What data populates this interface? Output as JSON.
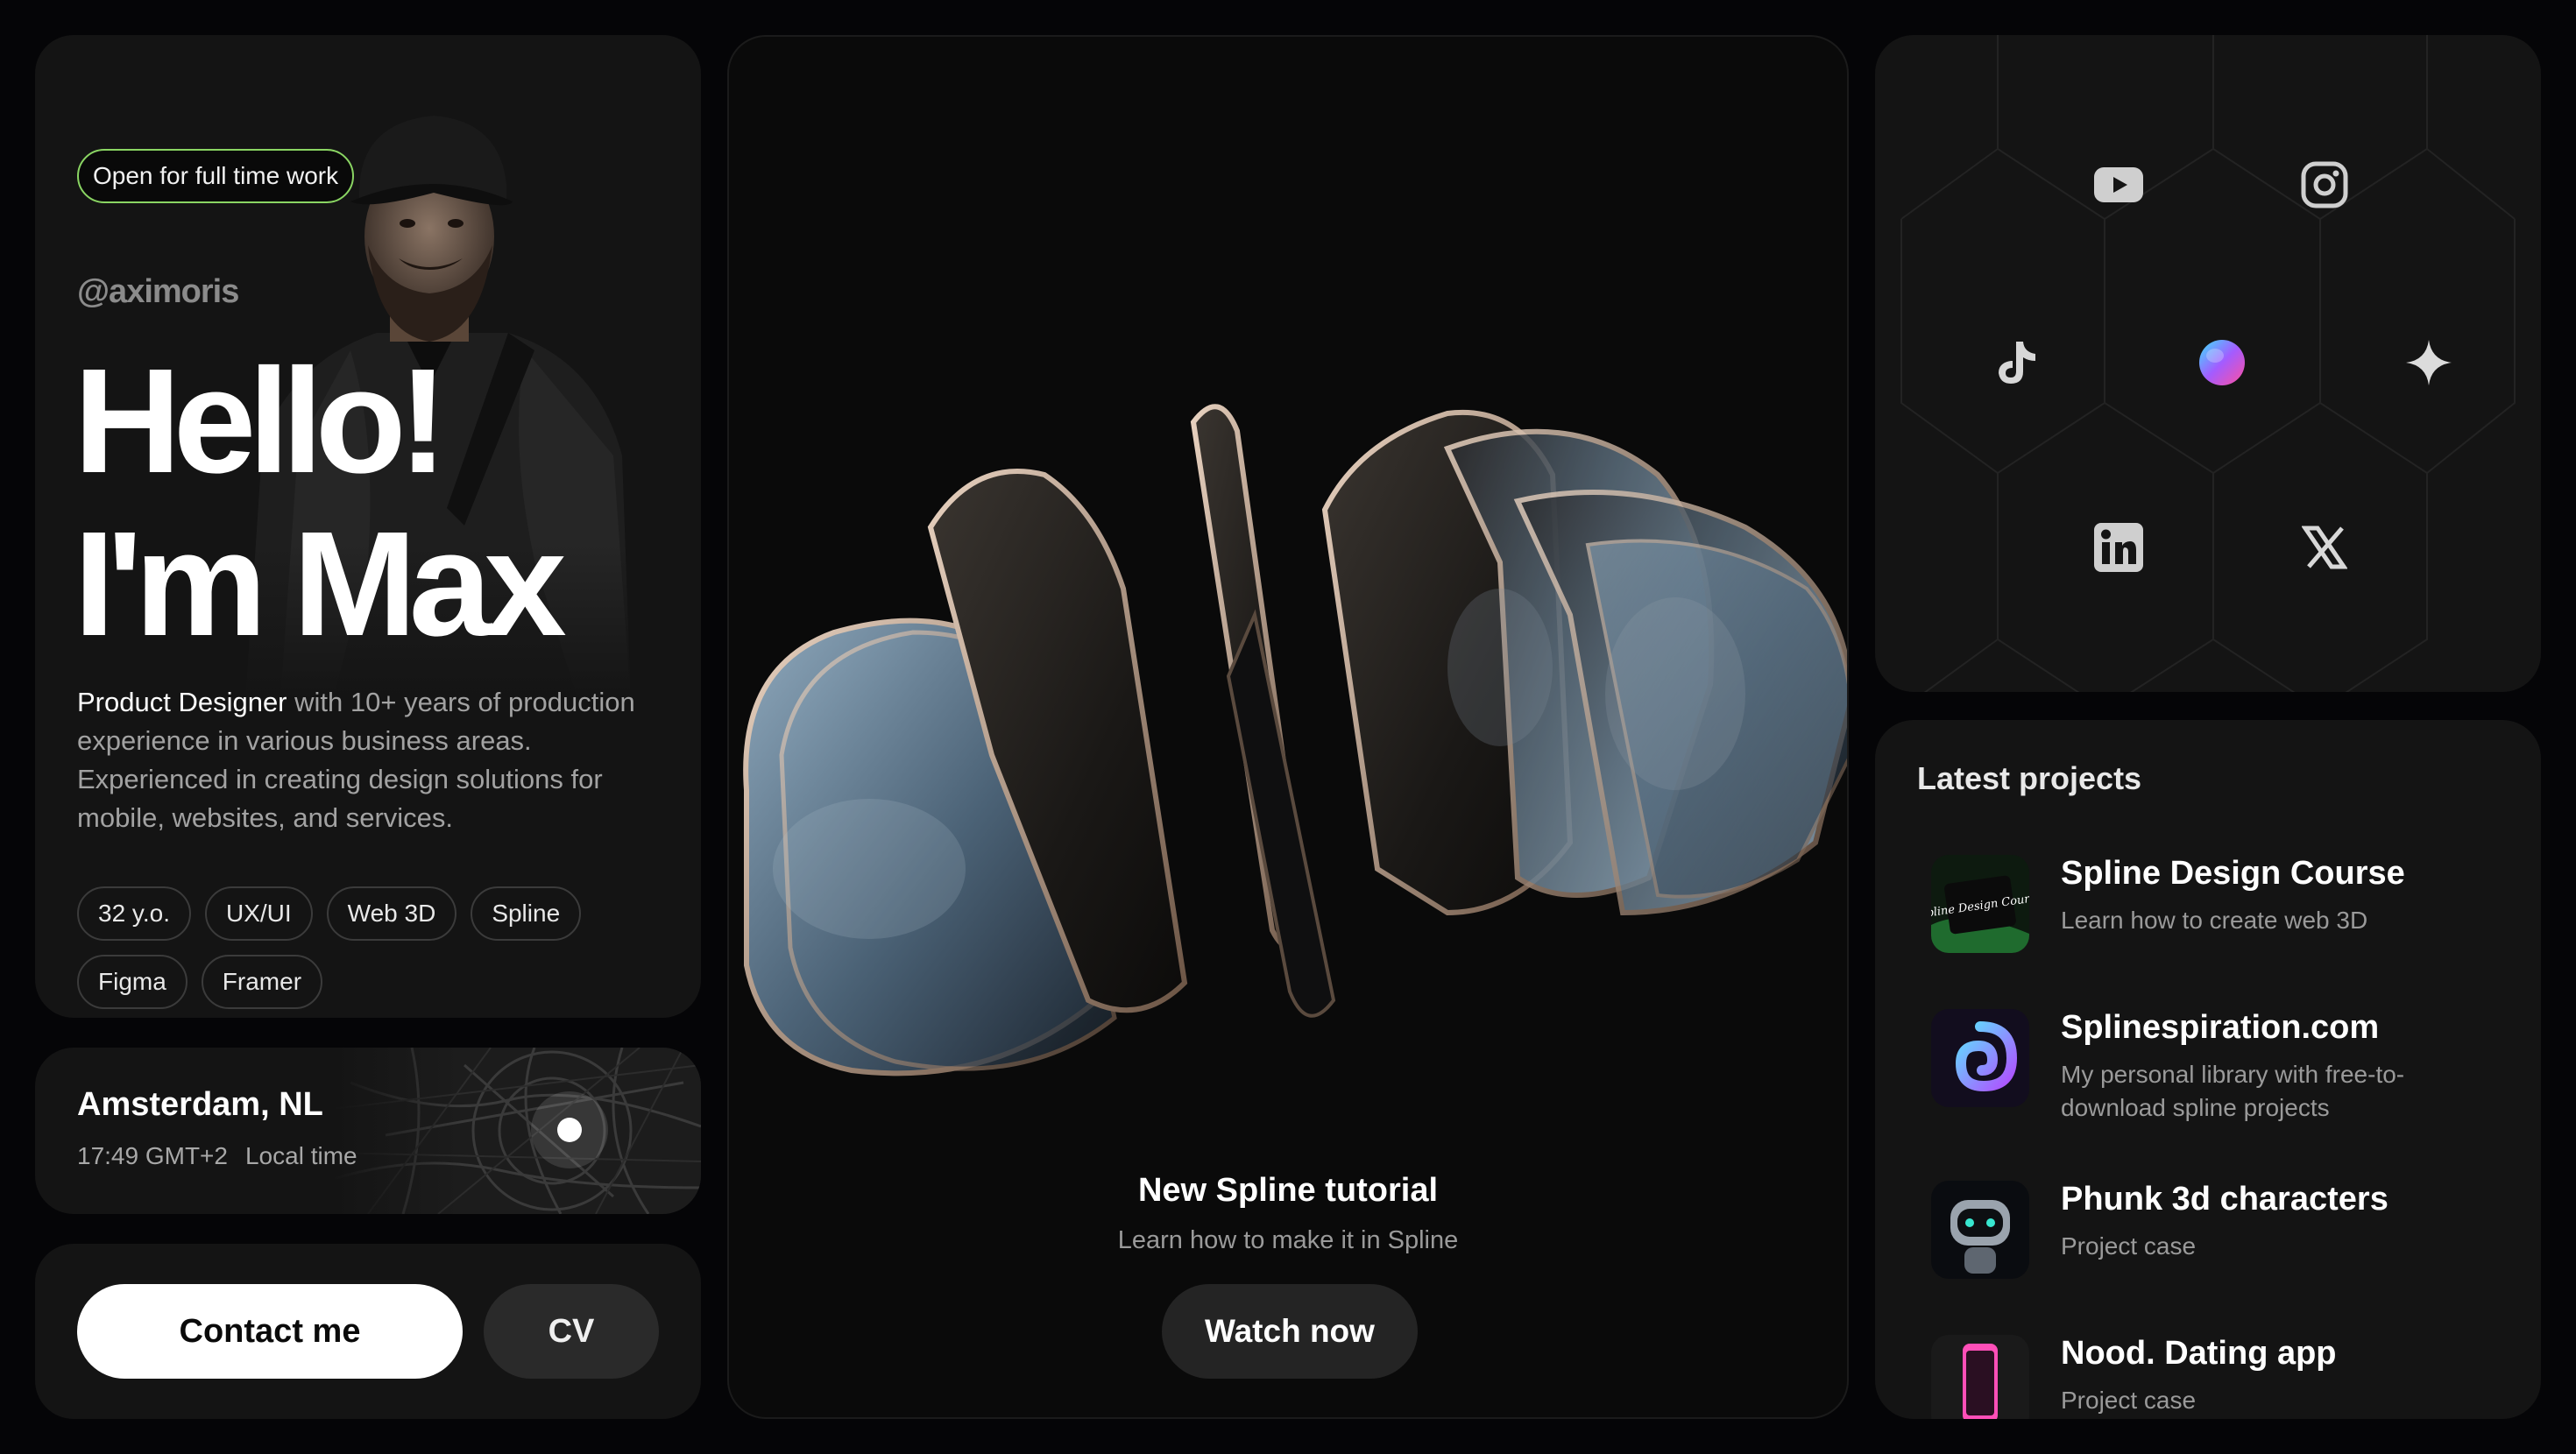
{
  "profile": {
    "status_badge": "Open for full time work",
    "handle": "@aximoris",
    "greeting_line1": "Hello!",
    "greeting_line2": "I'm Max",
    "bio_highlight": "Product Designer",
    "bio_rest": " with 10+ years of production experience in various business areas. Experienced in creating design solutions for mobile, websites, and services.",
    "tags": [
      "32 y.o.",
      "UX/UI",
      "Web 3D",
      "Spline",
      "Figma",
      "Framer"
    ]
  },
  "location": {
    "city": "Amsterdam, NL",
    "time": "17:49 GMT+2",
    "time_label": "Local time"
  },
  "actions": {
    "contact_label": "Contact me",
    "cv_label": "CV"
  },
  "tutorial": {
    "title": "New Spline tutorial",
    "subtitle": "Learn how to make it in Spline",
    "button_label": "Watch now"
  },
  "social": {
    "icons": [
      "youtube-icon",
      "instagram-icon",
      "tiktok-icon",
      "spline-icon",
      "sparkle-icon",
      "linkedin-icon",
      "x-icon"
    ]
  },
  "projects": {
    "title": "Latest projects",
    "items": [
      {
        "name": "Spline Design Course",
        "desc": "Learn how to create web 3D",
        "thumb_text": "Spline Design Course"
      },
      {
        "name": "Splinespiration.com",
        "desc": "My personal library with free-to-download spline projects"
      },
      {
        "name": "Phunk 3d characters",
        "desc": "Project case"
      },
      {
        "name": "Nood. Dating app",
        "desc": "Project case"
      }
    ]
  },
  "colors": {
    "background": "#050507",
    "card": "#141414",
    "status_green": "#8ad563",
    "muted_text": "#a2a2a2"
  }
}
